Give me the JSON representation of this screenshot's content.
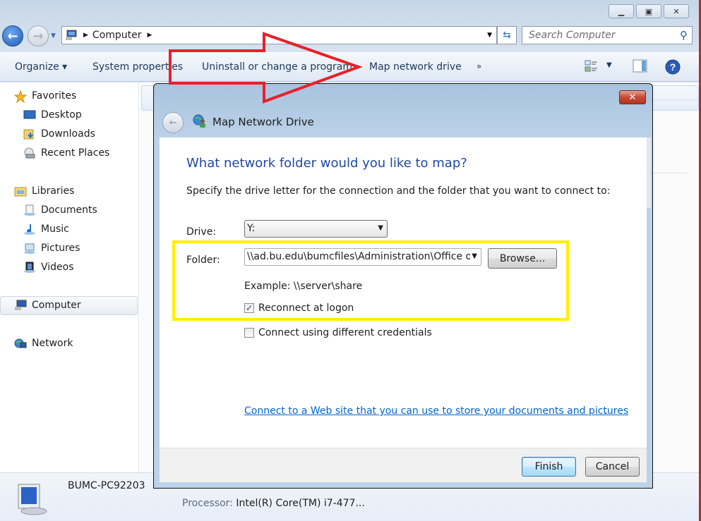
{
  "window": {
    "caption_buttons": [
      "minimize",
      "restore",
      "close"
    ]
  },
  "nav": {
    "address_icon": "computer-icon",
    "address_segments": [
      "Computer"
    ],
    "search_placeholder": "Search Computer"
  },
  "toolbar": {
    "organize": "Organize ▾",
    "system_properties": "System properties",
    "uninstall": "Uninstall or change a program",
    "map_drive": "Map network drive",
    "more": "»"
  },
  "sidebar": {
    "favorites": "Favorites",
    "favorites_items": [
      "Desktop",
      "Downloads",
      "Recent Places"
    ],
    "libraries": "Libraries",
    "libraries_items": [
      "Documents",
      "Music",
      "Pictures",
      "Videos"
    ],
    "computer": "Computer",
    "network": "Network"
  },
  "details": {
    "computer_name": "BUMC-PC92203",
    "processor_label": "Processor:",
    "processor_value": "Intel(R) Core(TM) i7-477..."
  },
  "dialog": {
    "title": "Map Network Drive",
    "heading": "What network folder would you like to map?",
    "instructions": "Specify the drive letter for the connection and the folder that you want to connect to:",
    "drive_label": "Drive:",
    "drive_value": "Y:",
    "folder_label": "Folder:",
    "folder_value": "\\\\ad.bu.edu\\bumcfiles\\Administration\\Office o",
    "browse": "Browse...",
    "example": "Example: \\\\server\\share",
    "reconnect": "Reconnect at logon",
    "reconnect_checked": true,
    "diff_credentials": "Connect using different credentials",
    "diff_credentials_checked": false,
    "web_link": "Connect to a Web site that you can use to store your documents and pictures",
    "web_link_suffix": ".",
    "finish": "Finish",
    "cancel": "Cancel"
  },
  "annotations": {
    "arrow_color": "#e8202a",
    "highlight_color": "#ffef00"
  }
}
